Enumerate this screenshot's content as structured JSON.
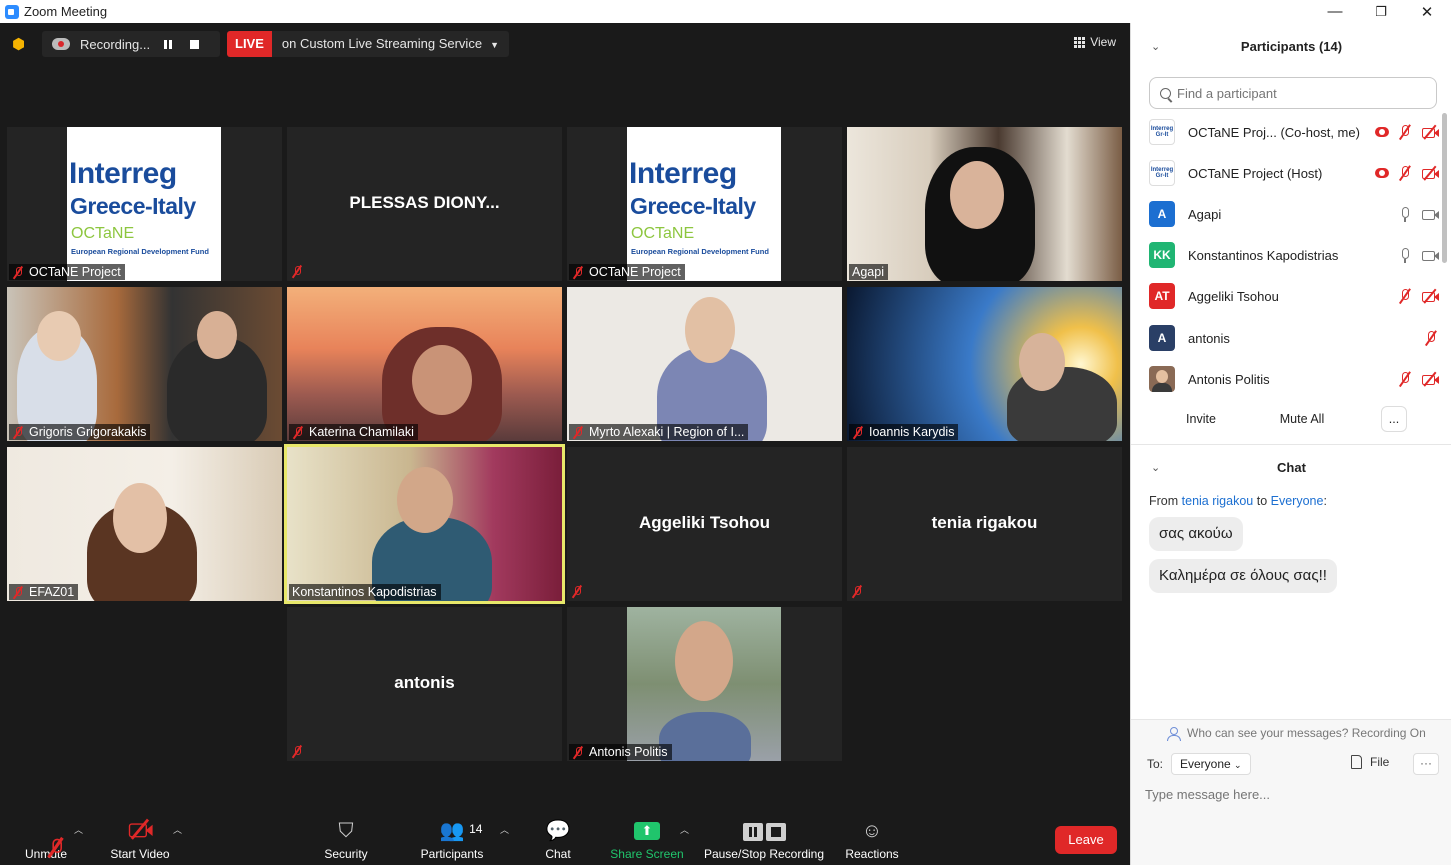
{
  "window": {
    "title": "Zoom Meeting",
    "minimize": "—",
    "restore": "❐",
    "close": "✕"
  },
  "topbar": {
    "recording_label": "Recording...",
    "live_badge": "LIVE",
    "live_service": "on Custom Live Streaming Service",
    "view_label": "View"
  },
  "tiles": [
    {
      "name": "OCTaNE Project",
      "type": "logo"
    },
    {
      "name": "PLESSAS  DIONY...",
      "type": "name-only"
    },
    {
      "name": "OCTaNE Project",
      "type": "logo"
    },
    {
      "name": "Agapi",
      "type": "video"
    },
    {
      "name": "Grigoris Grigorakakis",
      "type": "video"
    },
    {
      "name": "Katerina Chamilaki",
      "type": "video"
    },
    {
      "name": "Myrto Alexaki | Region of I...",
      "type": "video"
    },
    {
      "name": "Ioannis Karydis",
      "type": "video"
    },
    {
      "name": "EFAZ01",
      "type": "video"
    },
    {
      "name": "Konstantinos Kapodistrias",
      "type": "video",
      "active": true
    },
    {
      "name": "Aggeliki Tsohou",
      "type": "name-only"
    },
    {
      "name": "tenia rigakou",
      "type": "name-only"
    },
    {
      "name": "antonis",
      "type": "name-only"
    },
    {
      "name": "Antonis Politis",
      "type": "video"
    }
  ],
  "logo": {
    "line1": "Interreg",
    "line2": "Greece-Italy",
    "line3": "OCTaNE",
    "line4": "European Regional Development Fund"
  },
  "toolbar": {
    "unmute": "Unmute",
    "start_video": "Start Video",
    "security": "Security",
    "participants": "Participants",
    "participants_count": "14",
    "chat": "Chat",
    "share_screen": "Share Screen",
    "pause_stop_recording": "Pause/Stop Recording",
    "reactions": "Reactions",
    "leave": "Leave"
  },
  "participants_panel": {
    "title": "Participants (14)",
    "search_placeholder": "Find a participant",
    "list": [
      {
        "name": "OCTaNE Proj... (Co-host, me)",
        "avatar": "logo",
        "initials": "",
        "color": "#ffffff"
      },
      {
        "name": "OCTaNE Project (Host)",
        "avatar": "logo",
        "initials": "",
        "color": "#ffffff"
      },
      {
        "name": "Agapi",
        "avatar": "initials",
        "initials": "A",
        "color": "#1c6fd1"
      },
      {
        "name": "Konstantinos Kapodistrias",
        "avatar": "initials",
        "initials": "KK",
        "color": "#20b573"
      },
      {
        "name": "Aggeliki Tsohou",
        "avatar": "initials",
        "initials": "AT",
        "color": "#e02828"
      },
      {
        "name": "antonis",
        "avatar": "initials",
        "initials": "A",
        "color": "#2a3f66"
      },
      {
        "name": "Antonis Politis",
        "avatar": "photo",
        "initials": "",
        "color": "#8a6a55"
      }
    ],
    "invite": "Invite",
    "mute_all": "Mute All",
    "more": "..."
  },
  "chat": {
    "title": "Chat",
    "from_prefix": "From",
    "from_name": "tenia rigakou",
    "to_word": "to",
    "to_name": "Everyone",
    "colon": ":",
    "messages": [
      "σας ακούω",
      "Καλημέρα σε όλους σας!!"
    ],
    "visibility_note": "Who can see your messages? Recording On",
    "to_label": "To:",
    "recipient": "Everyone",
    "file_label": "File",
    "more": "···",
    "input_placeholder": "Type message here..."
  }
}
